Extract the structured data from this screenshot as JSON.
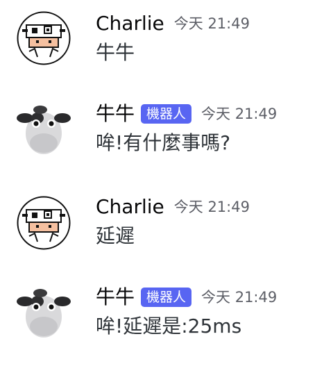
{
  "messages": [
    {
      "author": "Charlie",
      "is_bot": false,
      "timestamp": "今天 21:49",
      "content": "牛牛",
      "avatar": "pixel-cow-avatar"
    },
    {
      "author": "牛牛",
      "is_bot": true,
      "bot_tag": "機器人",
      "timestamp": "今天 21:49",
      "content": "哞!有什麼事嗎?",
      "avatar": "plush-cow-avatar"
    },
    {
      "author": "Charlie",
      "is_bot": false,
      "timestamp": "今天 21:49",
      "content": "延遲",
      "avatar": "pixel-cow-avatar"
    },
    {
      "author": "牛牛",
      "is_bot": true,
      "bot_tag": "機器人",
      "timestamp": "今天 21:49",
      "content": "哞!延遲是:25ms",
      "avatar": "plush-cow-avatar"
    }
  ],
  "colors": {
    "bot_tag_bg": "#5865f2",
    "timestamp": "#5c5e66",
    "text": "#2e3338"
  }
}
